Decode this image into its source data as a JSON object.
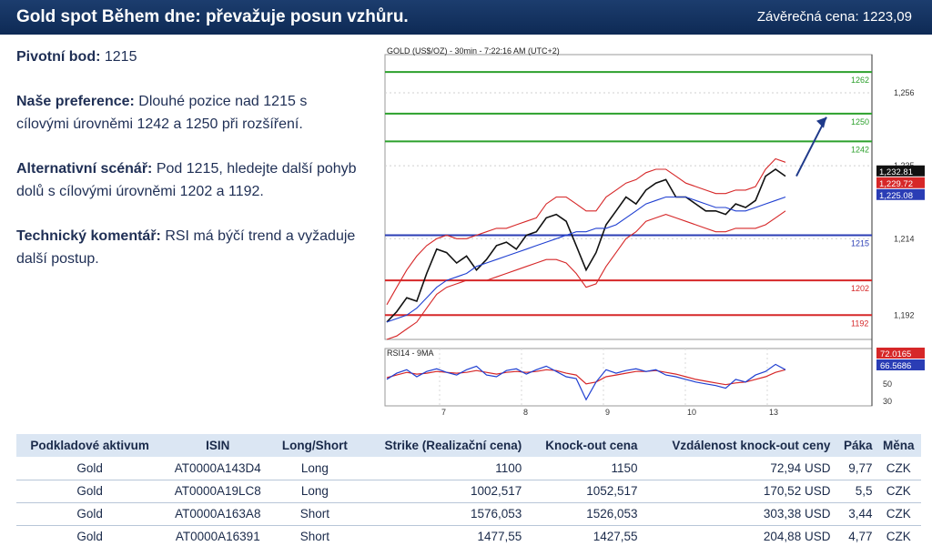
{
  "header": {
    "title": "Gold spot Během dne: převažuje posun vzhůru.",
    "close_label": "Závěrečná cena: 1223,09"
  },
  "analysis": {
    "pivot_label": "Pivotní bod:",
    "pivot_value": " 1215",
    "pref_label": "Naše preference:",
    "pref_text": " Dlouhé pozice nad 1215 s cílovými úrovněmi 1242 a 1250 při  rozšíření.",
    "alt_label": "Alternativní scénář:",
    "alt_text": " Pod 1215, hledejte další pohyb dolů s cílovými úrovněmi 1202 a 1192.",
    "tech_label": "Technický komentář:",
    "tech_text": " RSI má býčí trend a vyžaduje další postup."
  },
  "chart_data": {
    "type": "line",
    "title": "GOLD (US$/OZ) - 30min - 7:22:16 AM (UTC+2)",
    "x_ticks": [
      "7",
      "8",
      "9",
      "10",
      "13"
    ],
    "y_ticks": [
      "1,256",
      "1,235",
      "1,214",
      "1,192"
    ],
    "ylim": [
      1185,
      1267
    ],
    "levels": [
      {
        "label": "1262",
        "value": 1262,
        "color": "#2ca02c"
      },
      {
        "label": "1250",
        "value": 1250,
        "color": "#2ca02c"
      },
      {
        "label": "1242",
        "value": 1242,
        "color": "#2ca02c"
      },
      {
        "label": "1215",
        "value": 1215,
        "color": "#2a3db5"
      },
      {
        "label": "1202",
        "value": 1202,
        "color": "#d62728"
      },
      {
        "label": "1192",
        "value": 1192,
        "color": "#d62728"
      }
    ],
    "price_badges": [
      {
        "label": "1,232.81",
        "color": "#111111"
      },
      {
        "label": "1,229.72",
        "color": "#d62728"
      },
      {
        "label": "1,225.08",
        "color": "#2a3db5"
      }
    ],
    "series": [
      {
        "name": "price",
        "values": [
          1190,
          1193,
          1197,
          1196,
          1204,
          1211,
          1210,
          1207,
          1209,
          1205,
          1208,
          1212,
          1213,
          1211,
          1215,
          1216,
          1220,
          1221,
          1219,
          1212,
          1205,
          1210,
          1218,
          1222,
          1226,
          1224,
          1228,
          1230,
          1231,
          1226,
          1226,
          1224,
          1222,
          1222,
          1221,
          1224,
          1223,
          1225,
          1232,
          1234,
          1232
        ]
      },
      {
        "name": "ma",
        "values": [
          1190,
          1191,
          1192,
          1194,
          1197,
          1200,
          1202,
          1203,
          1204,
          1206,
          1207,
          1208,
          1209,
          1210,
          1211,
          1212,
          1213,
          1214,
          1215,
          1216,
          1216,
          1217,
          1217,
          1218,
          1220,
          1222,
          1224,
          1225,
          1226,
          1226,
          1226,
          1225,
          1224,
          1223,
          1223,
          1222,
          1222,
          1223,
          1224,
          1225,
          1226
        ]
      },
      {
        "name": "upper",
        "values": [
          1195,
          1200,
          1205,
          1209,
          1212,
          1214,
          1215,
          1214,
          1214,
          1215,
          1216,
          1217,
          1217,
          1218,
          1219,
          1220,
          1224,
          1226,
          1226,
          1224,
          1222,
          1222,
          1226,
          1228,
          1230,
          1231,
          1233,
          1234,
          1234,
          1232,
          1230,
          1229,
          1228,
          1227,
          1227,
          1228,
          1228,
          1229,
          1234,
          1237,
          1236
        ]
      },
      {
        "name": "lower",
        "values": [
          1185,
          1186,
          1188,
          1190,
          1194,
          1198,
          1200,
          1201,
          1202,
          1202,
          1202,
          1203,
          1204,
          1205,
          1206,
          1207,
          1208,
          1208,
          1207,
          1204,
          1200,
          1201,
          1206,
          1210,
          1214,
          1216,
          1219,
          1220,
          1221,
          1220,
          1219,
          1218,
          1217,
          1216,
          1216,
          1217,
          1217,
          1217,
          1218,
          1220,
          1222
        ]
      }
    ],
    "rsi": {
      "title": "RSI14 - 9MA",
      "y_ticks": [
        "50",
        "30"
      ],
      "ylim": [
        25,
        90
      ],
      "badges": [
        {
          "label": "72.0165",
          "color": "#d62728"
        },
        {
          "label": "66.5686",
          "color": "#2a3db5"
        }
      ],
      "values": [
        55,
        62,
        66,
        58,
        64,
        67,
        63,
        60,
        66,
        70,
        60,
        58,
        65,
        67,
        61,
        66,
        70,
        64,
        58,
        56,
        32,
        52,
        66,
        62,
        65,
        67,
        64,
        66,
        60,
        58,
        55,
        52,
        50,
        48,
        45,
        55,
        52,
        60,
        64,
        72,
        66
      ],
      "ma": [
        57,
        60,
        63,
        61,
        62,
        64,
        63,
        62,
        63,
        65,
        63,
        61,
        63,
        64,
        63,
        64,
        66,
        65,
        62,
        60,
        50,
        52,
        58,
        60,
        62,
        64,
        64,
        65,
        63,
        61,
        58,
        55,
        53,
        51,
        49,
        51,
        52,
        55,
        58,
        63,
        66
      ]
    }
  },
  "table": {
    "headers": [
      "Podkladové aktivum",
      "ISIN",
      "Long/Short",
      "Strike (Realizační cena)",
      "Knock-out cena",
      "Vzdálenost knock-out ceny",
      "Páka",
      "Měna"
    ],
    "rows": [
      [
        "Gold",
        "AT0000A143D4",
        "Long",
        "1100",
        "1150",
        "72,94 USD",
        "9,77",
        "CZK"
      ],
      [
        "Gold",
        "AT0000A19LC8",
        "Long",
        "1002,517",
        "1052,517",
        "170,52 USD",
        "5,5",
        "CZK"
      ],
      [
        "Gold",
        "AT0000A163A8",
        "Short",
        "1576,053",
        "1526,053",
        "303,38 USD",
        "3,44",
        "CZK"
      ],
      [
        "Gold",
        "AT0000A16391",
        "Short",
        "1477,55",
        "1427,55",
        "204,88 USD",
        "4,77",
        "CZK"
      ]
    ]
  }
}
